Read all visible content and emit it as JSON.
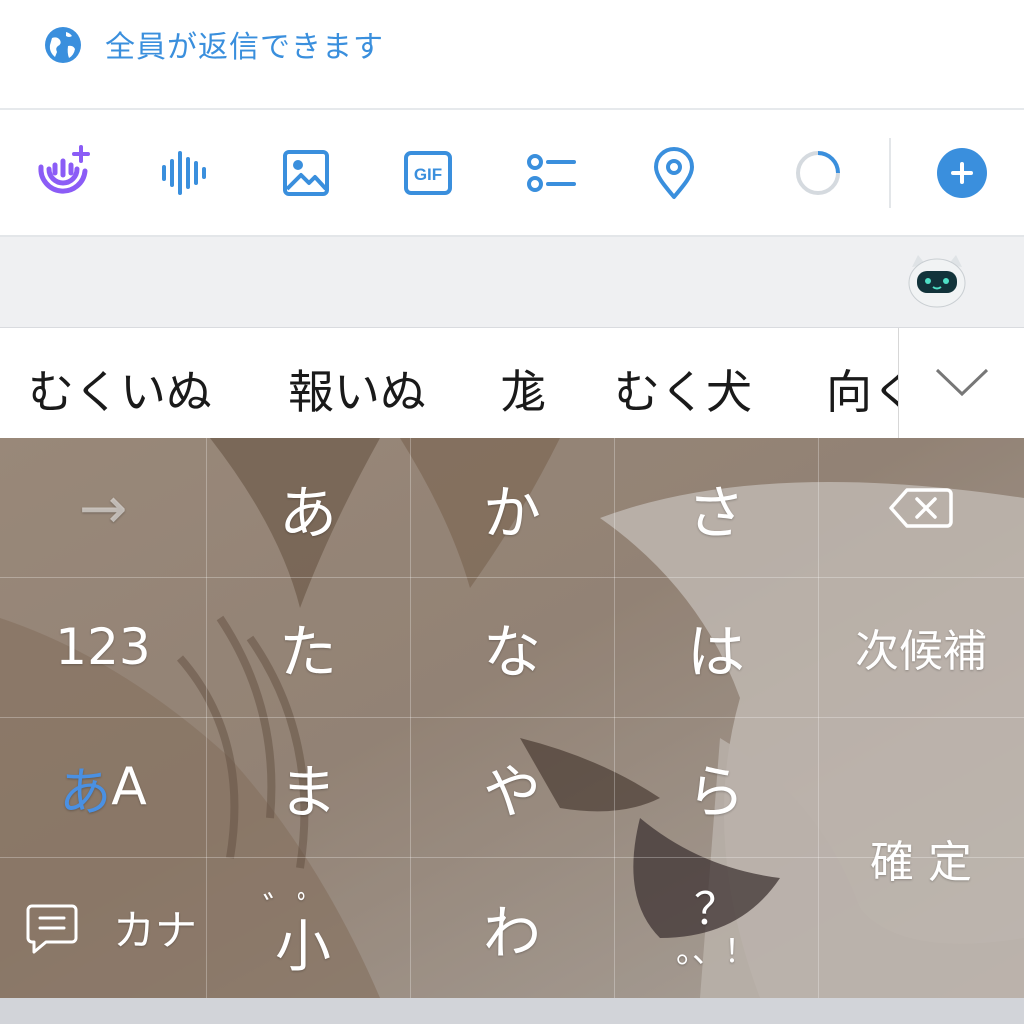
{
  "reply_setting": {
    "text": "全員が返信できます",
    "icon": "globe-icon"
  },
  "toolbar": {
    "icons": [
      "spaces-voice-icon",
      "audio-waveform-icon",
      "image-icon",
      "gif-icon",
      "poll-icon",
      "location-pin-icon",
      "character-count-ring-icon",
      "add-tweet-icon"
    ],
    "gif_label": "GIF",
    "accent": "#3a8fdd"
  },
  "suggestion_bar": {
    "mascot": "robot-mascot-icon"
  },
  "candidates": {
    "items": [
      "むくいぬ",
      "報いぬ",
      "尨",
      "むく犬",
      "向く"
    ],
    "expand_icon": "chevron-down-icon"
  },
  "keyboard": {
    "arrow": "→",
    "row1": [
      "あ",
      "か",
      "さ"
    ],
    "backspace_icon": "backspace-icon",
    "numbers": "123",
    "row2": [
      "た",
      "な",
      "は"
    ],
    "next_candidate": "次候補",
    "mode_a": "あ",
    "mode_b": "A",
    "row3": [
      "ま",
      "や",
      "ら"
    ],
    "confirm": "確 定",
    "comment_icon": "comment-icon",
    "kana": "カナ",
    "dakuten": "゛ﾟ",
    "small_kana": "小",
    "wa": "わ",
    "punct_top": "？",
    "punct_bottom": "。、！",
    "mode_a_color": "#4a90e2"
  }
}
